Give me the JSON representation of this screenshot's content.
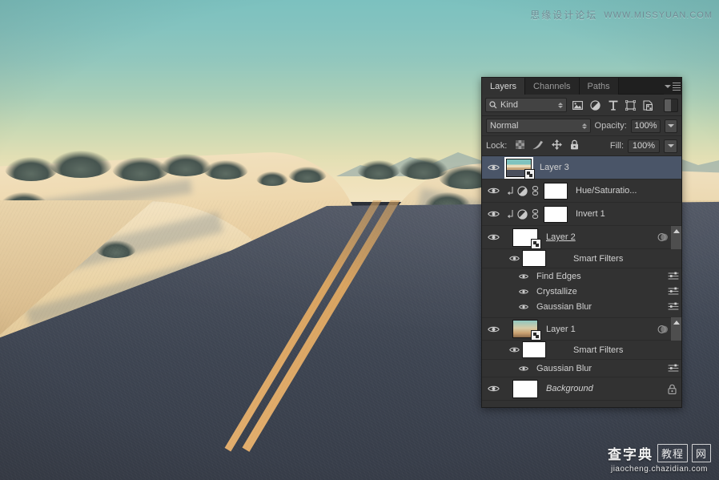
{
  "watermarks": {
    "top_cn": "思缘设计论坛",
    "top_url": "WWW.MISSYUAN.COM",
    "bottom_cn": "查字典",
    "bottom_boxed_1": "教程",
    "bottom_boxed_2": "网",
    "bottom_url": "jiaocheng.chazidian.com"
  },
  "panel": {
    "tabs": [
      {
        "label": "Layers",
        "active": true
      },
      {
        "label": "Channels",
        "active": false
      },
      {
        "label": "Paths",
        "active": false
      }
    ],
    "menu_icon": "panel-menu-icon",
    "filter_row": {
      "kind_label": "Kind",
      "search_icon": "search-icon",
      "icons": [
        "pixel-layer-filter-icon",
        "adjustment-layer-filter-icon",
        "type-layer-filter-icon",
        "shape-layer-filter-icon",
        "smart-object-filter-icon"
      ],
      "toggle_name": "filter-enable-toggle"
    },
    "blend_row": {
      "blend_mode": "Normal",
      "opacity_label": "Opacity:",
      "opacity_value": "100%"
    },
    "lock_row": {
      "lock_label": "Lock:",
      "lock_icons": [
        "lock-transparent-pixels-icon",
        "lock-image-pixels-icon",
        "lock-position-icon",
        "lock-all-icon"
      ],
      "fill_label": "Fill:",
      "fill_value": "100%"
    },
    "layers": [
      {
        "name": "Layer 3",
        "type": "smart-object",
        "selected": true,
        "visible": true,
        "thumb": "photo",
        "smart_badge": true
      },
      {
        "name": "Hue/Saturatio...",
        "type": "adjustment",
        "selected": false,
        "visible": true,
        "clipped": true,
        "linked": true,
        "mask": true
      },
      {
        "name": "Invert 1",
        "type": "adjustment",
        "selected": false,
        "visible": true,
        "clipped": true,
        "linked": true,
        "mask": true
      },
      {
        "name": "Layer 2",
        "type": "smart-object",
        "selected": false,
        "visible": true,
        "thumb": "white",
        "smart_badge": true,
        "has_fx": true,
        "expanded": true,
        "smart_filters_label": "Smart Filters",
        "filters": [
          "Find Edges",
          "Crystallize",
          "Gaussian Blur"
        ]
      },
      {
        "name": "Layer 1",
        "type": "smart-object",
        "selected": false,
        "visible": true,
        "thumb": "gradient",
        "smart_badge": true,
        "has_fx": true,
        "expanded": true,
        "smart_filters_label": "Smart Filters",
        "filters": [
          "Gaussian Blur"
        ]
      },
      {
        "name": "Background",
        "type": "background",
        "selected": false,
        "visible": true,
        "thumb": "white",
        "locked": true
      }
    ]
  },
  "colors": {
    "panel_bg": "#2d2d2d",
    "list_bg": "#323232",
    "selected_row": "#4a5568",
    "text": "#d2d2d2",
    "sky_top": "#7cc1bf",
    "sky_bottom": "#f2e4c2",
    "sand": "#e8d2a6",
    "asphalt": "#464d5a",
    "centerline": "#d9a461"
  }
}
